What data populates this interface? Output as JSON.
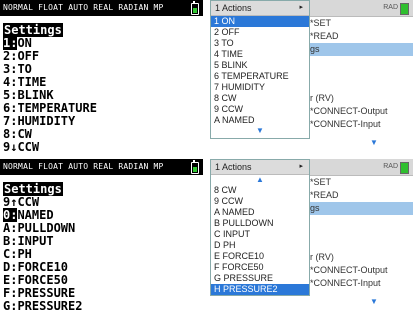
{
  "calc_top": {
    "status": "NORMAL FLOAT AUTO REAL RADIAN MP",
    "title": "Settings",
    "lines": [
      {
        "key": "1:",
        "text": "ON",
        "selected": true
      },
      {
        "key": "2:",
        "text": "OFF"
      },
      {
        "key": "3:",
        "text": "TO"
      },
      {
        "key": "4:",
        "text": "TIME"
      },
      {
        "key": "5:",
        "text": "BLINK"
      },
      {
        "key": "6:",
        "text": "TEMPERATURE"
      },
      {
        "key": "7:",
        "text": "HUMIDITY"
      },
      {
        "key": "8:",
        "text": "CW"
      },
      {
        "key": "9↓",
        "text": "CCW"
      }
    ]
  },
  "calc_bottom": {
    "status": "NORMAL FLOAT AUTO REAL RADIAN MP",
    "title": "Settings",
    "lines": [
      {
        "key": "9↑",
        "text": "CCW"
      },
      {
        "key": "0:",
        "text": "NAMED",
        "selected": true
      },
      {
        "key": "A:",
        "text": "PULLDOWN"
      },
      {
        "key": "B:",
        "text": "INPUT"
      },
      {
        "key": "C:",
        "text": "PH"
      },
      {
        "key": "D:",
        "text": "FORCE10"
      },
      {
        "key": "E:",
        "text": "FORCE50"
      },
      {
        "key": "F:",
        "text": "PRESSURE"
      },
      {
        "key": "G:",
        "text": "PRESSURE2"
      }
    ]
  },
  "hh_top": {
    "rad": "RAD",
    "menu_title": "1  Actions",
    "items": [
      {
        "label": "1  ON",
        "selected": true
      },
      {
        "label": "2  OFF"
      },
      {
        "label": "3  TO"
      },
      {
        "label": "4  TIME"
      },
      {
        "label": "5  BLINK"
      },
      {
        "label": "6  TEMPERATURE"
      },
      {
        "label": "7  HUMIDITY"
      },
      {
        "label": "8  CW"
      },
      {
        "label": "9  CCW"
      },
      {
        "label": "A  NAMED"
      }
    ],
    "bg": {
      "set": "*SET",
      "read": "*READ",
      "gs": "gs",
      "rv": "r (RV)",
      "co": "*CONNECT-Output",
      "ci": "*CONNECT-Input"
    },
    "down_arrow": "▼"
  },
  "hh_bottom": {
    "rad": "RAD",
    "menu_title": "1  Actions",
    "up_arrow": "▲",
    "items": [
      {
        "label": "8  CW"
      },
      {
        "label": "9  CCW"
      },
      {
        "label": "A  NAMED"
      },
      {
        "label": "B  PULLDOWN"
      },
      {
        "label": "C  INPUT"
      },
      {
        "label": "D  PH"
      },
      {
        "label": "E  FORCE10"
      },
      {
        "label": "F  FORCE50"
      },
      {
        "label": "G  PRESSURE"
      },
      {
        "label": "H  PRESSURE2",
        "selected": true
      }
    ],
    "bg": {
      "set": "*SET",
      "read": "*READ",
      "gs": "gs",
      "rv": "r (RV)",
      "co": "*CONNECT-Output",
      "ci": "*CONNECT-Input"
    },
    "down_arrow": "▼"
  },
  "colors": {
    "highlight": "#2b78d8",
    "band": "#9fc6ea",
    "battery": "#32c832"
  }
}
